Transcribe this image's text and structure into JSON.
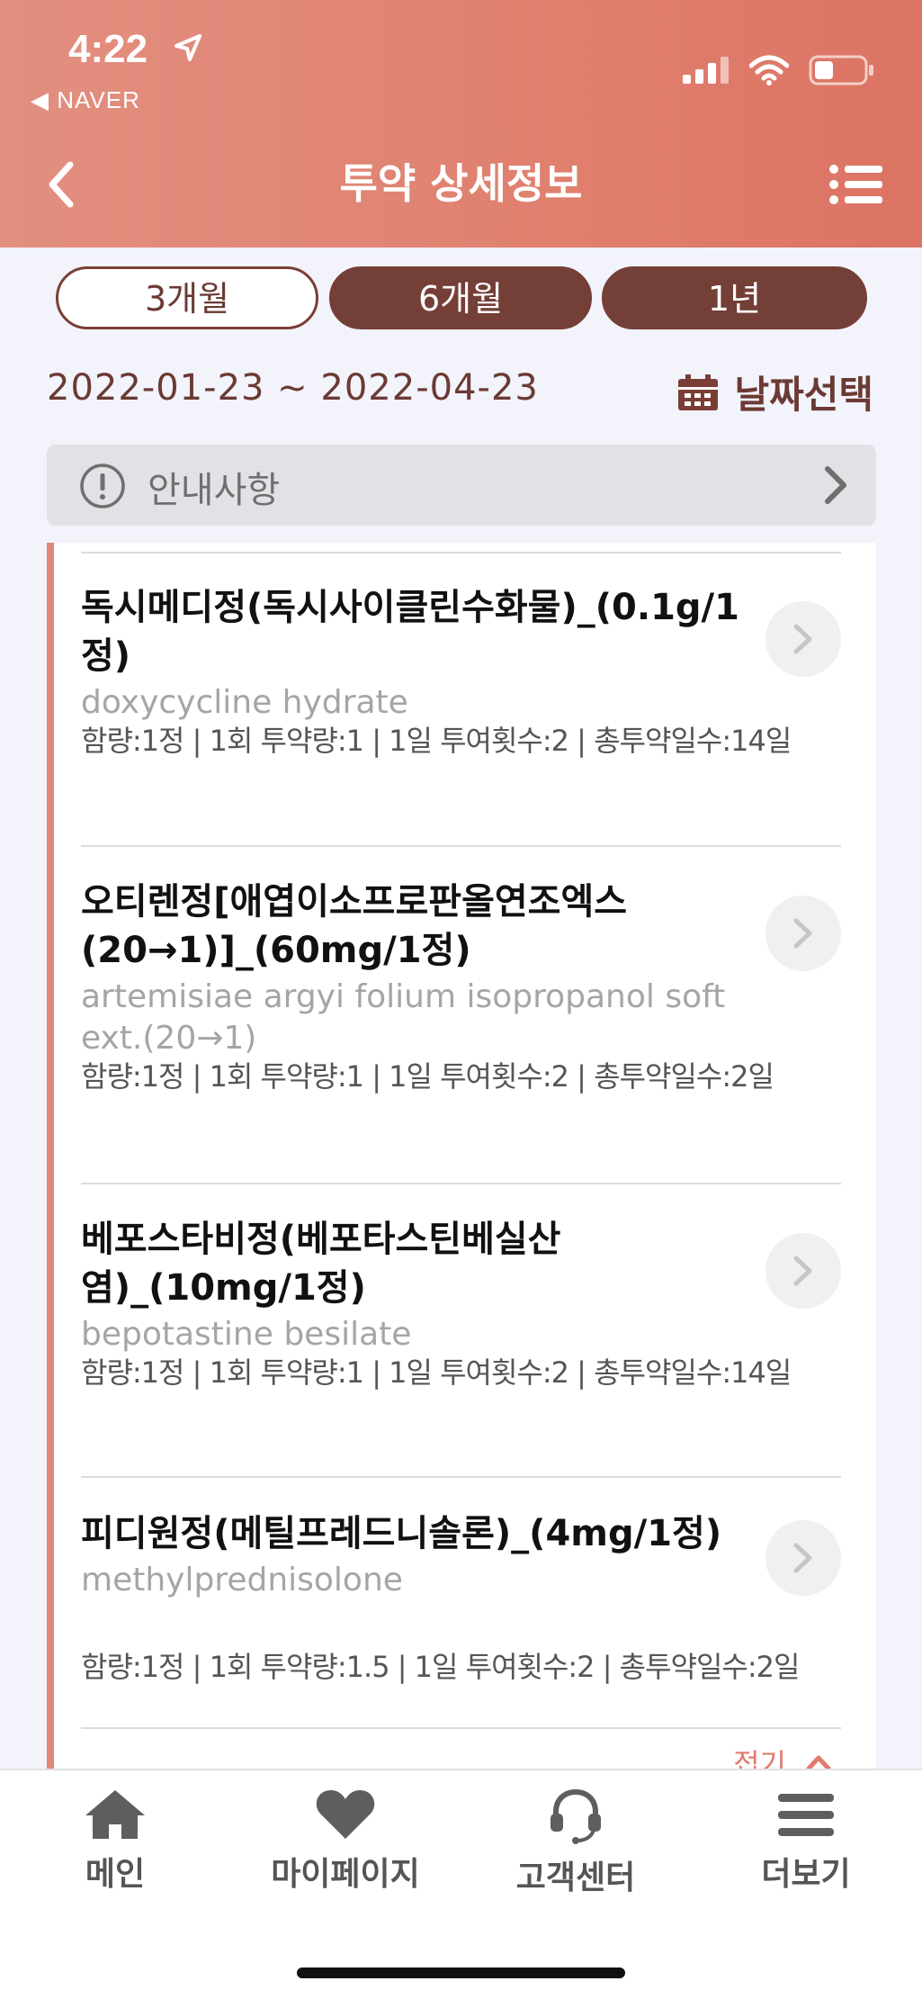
{
  "status_bar": {
    "time": "4:22",
    "back_app": "◀ NAVER",
    "location_icon": "location-arrow-icon",
    "signal_icon": "cellular-signal-icon",
    "wifi_icon": "wifi-icon",
    "battery_icon": "battery-icon"
  },
  "header": {
    "title": "투약 상세정보",
    "back_icon": "chevron-left-icon",
    "menu_icon": "list-menu-icon"
  },
  "periods": [
    {
      "label": "3개월",
      "selected": false
    },
    {
      "label": "6개월",
      "selected": true
    },
    {
      "label": "1년",
      "selected": true
    }
  ],
  "date_range": "2022-01-23 ~ 2022-04-23",
  "date_select": {
    "label": "날짜선택",
    "icon": "calendar-icon"
  },
  "notice": {
    "label": "안내사항",
    "icon": "exclamation-circle-icon"
  },
  "medications": [
    {
      "name": "독시메디정(독시사이클린수화물)_(0.1g/1정)",
      "ingredient": "doxycycline hydrate",
      "dose": "함량:1정 | 1회 투약량:1 | 1일 투여횟수:2 | 총투약일수:14일"
    },
    {
      "name": "오티렌정[애엽이소프로판올연조엑스(20→1)]_(60mg/1정)",
      "ingredient": "artemisiae argyi folium isopropanol soft ext.(20→1)",
      "dose": "함량:1정 | 1회 투약량:1 | 1일 투여횟수:2 | 총투약일수:2일"
    },
    {
      "name": "베포스타비정(베포타스틴베실산염)_(10mg/1정)",
      "ingredient": "bepotastine besilate",
      "dose": "함량:1정 | 1회 투약량:1 | 1일 투여횟수:2 | 총투약일수:14일"
    },
    {
      "name": "피디원정(메틸프레드니솔론)_(4mg/1정)",
      "ingredient": "methylprednisolone",
      "dose": "함량:1정 | 1회 투약량:1.5 | 1일 투여횟수:2 | 총투약일수:2일"
    }
  ],
  "collapse_label": "접기",
  "tabbar": [
    {
      "label": "메인",
      "icon": "home-icon"
    },
    {
      "label": "마이페이지",
      "icon": "heart-icon"
    },
    {
      "label": "고객센터",
      "icon": "headset-icon"
    },
    {
      "label": "더보기",
      "icon": "hamburger-menu-icon"
    }
  ],
  "colors": {
    "header": "#e0806f",
    "selected_period": "#743f37",
    "accent": "#e2877a"
  }
}
